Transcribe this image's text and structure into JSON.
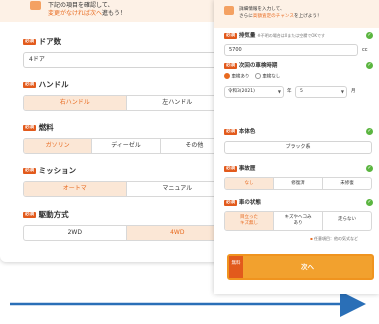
{
  "left": {
    "tip": {
      "line1": "下記の項目を確認して、",
      "line2_highlight": "変更がなければ次へ",
      "line2_rest": "進もう！"
    },
    "required_label": "必須",
    "doors": {
      "title": "ドア数",
      "value": "4ドア"
    },
    "steering": {
      "title": "ハンドル",
      "options": [
        "右ハンドル",
        "左ハンドル"
      ]
    },
    "fuel": {
      "title": "燃料",
      "options": [
        "ガソリン",
        "ディーゼル",
        "その他"
      ]
    },
    "transmission": {
      "title": "ミッション",
      "options": [
        "オートマ",
        "マニュアル"
      ]
    },
    "drive": {
      "title": "駆動方式",
      "options": [
        "2WD",
        "4WD"
      ]
    }
  },
  "right": {
    "tip": {
      "line1": "詳細情報を入力して、",
      "line2_pre": "さらに",
      "line2_highlight": "高額査定のチャンス",
      "line2_rest": "を上げよう！"
    },
    "required_label": "必須",
    "displacement": {
      "title": "排気量",
      "note": "※不明の場合は0または空欄でOKです",
      "value": "5700",
      "unit": "cc"
    },
    "inspection": {
      "title": "次回の車検時期",
      "radio_yes": "車検あり",
      "radio_no": "車検なし",
      "year": "令和3(2021)",
      "year_unit": "年",
      "month": "5",
      "month_unit": "月"
    },
    "body_color": {
      "title": "本体色",
      "value": "ブラック系"
    },
    "accident": {
      "title": "事故歴",
      "options": [
        "なし",
        "修復済",
        "未修復"
      ]
    },
    "condition": {
      "title": "車の状態",
      "options": [
        "目立った\nキズ無し",
        "キズやヘコみ\nあり",
        "走らない"
      ],
      "note": "任意項目：他の気式など"
    },
    "submit": {
      "side_label": "無料",
      "label": "次へ"
    }
  }
}
